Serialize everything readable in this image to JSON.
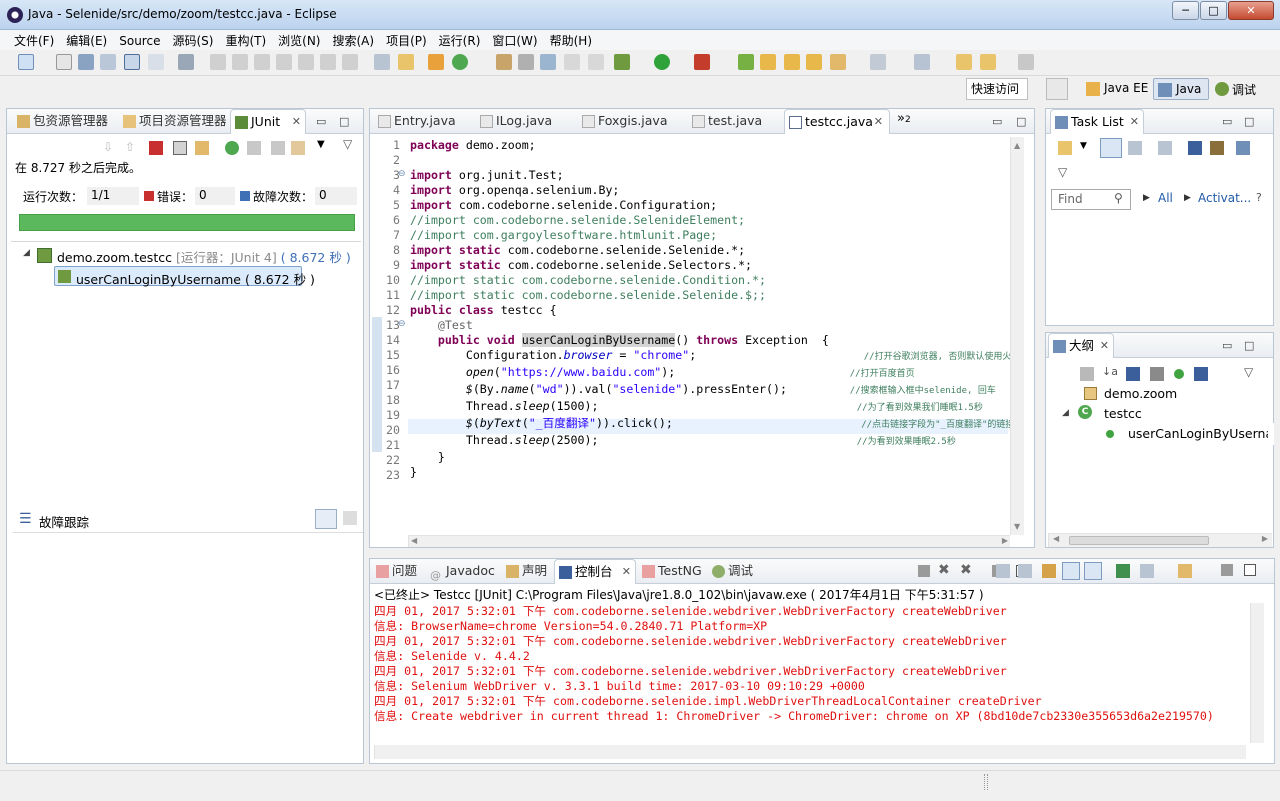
{
  "window": {
    "title": "Java - Selenide/src/demo/zoom/testcc.java - Eclipse",
    "btn_min": "─",
    "btn_max": "□",
    "btn_close": "✕"
  },
  "menu": [
    "文件(F)",
    "编辑(E)",
    "Source",
    "源码(S)",
    "重构(T)",
    "浏览(N)",
    "搜索(A)",
    "项目(P)",
    "运行(R)",
    "窗口(W)",
    "帮助(H)"
  ],
  "quick_access": "快速访问",
  "perspectives": [
    {
      "label": "Java EE"
    },
    {
      "label": "Java"
    },
    {
      "label": "调试"
    }
  ],
  "left_panel": {
    "tabs": [
      "包资源管理器",
      "项目资源管理器",
      "JUnit"
    ],
    "status": "在 8.727 秒之后完成。",
    "runs_label": "运行次数：",
    "runs_value": "1/1",
    "errors_label": "错误：",
    "errors_value": "0",
    "failures_label": "故障次数：",
    "failures_value": "0",
    "progress_color": "#5cb85c",
    "tree_root": "demo.zoom.testcc",
    "tree_root_runner": "[运行器：JUnit 4]",
    "tree_root_time": "( 8.672 秒 )",
    "tree_child": "userCanLoginByUsername ( 8.672 秒 )",
    "trace_label": "故障跟踪"
  },
  "editor": {
    "tabs": [
      "Entry.java",
      "ILog.java",
      "Foxgis.java",
      "test.java",
      "testcc.java"
    ],
    "overflow": "»",
    "overflow_count": "2"
  },
  "console": {
    "tabs": [
      "问题",
      "Javadoc",
      "声明",
      "控制台",
      "TestNG",
      "调试"
    ],
    "header": "<已终止> Testcc [JUnit] C:\\Program Files\\Java\\jre1.8.0_102\\bin\\javaw.exe ( 2017年4月1日 下午5:31:57 )",
    "lines": [
      "四月 01, 2017 5:32:01 下午 com.codeborne.selenide.webdriver.WebDriverFactory createWebDriver",
      "信息: BrowserName=chrome Version=54.0.2840.71 Platform=XP",
      "四月 01, 2017 5:32:01 下午 com.codeborne.selenide.webdriver.WebDriverFactory createWebDriver",
      "信息: Selenide v. 4.4.2",
      "四月 01, 2017 5:32:01 下午 com.codeborne.selenide.webdriver.WebDriverFactory createWebDriver",
      "信息: Selenium WebDriver v. 3.3.1 build time: 2017-03-10 09:10:29 +0000",
      "四月 01, 2017 5:32:01 下午 com.codeborne.selenide.impl.WebDriverThreadLocalContainer createDriver",
      "信息: Create webdriver in current thread 1: ChromeDriver -> ChromeDriver: chrome on XP (8bd10de7cb2330e355653d6a2e219570)"
    ]
  },
  "tasklist": {
    "tab": "Task List",
    "find_placeholder": "Find",
    "all": "All",
    "activate": "Activat..."
  },
  "outline": {
    "tab": "大纲",
    "pkg": "demo.zoom",
    "cls": "testcc",
    "method": "userCanLoginByUsername()"
  }
}
